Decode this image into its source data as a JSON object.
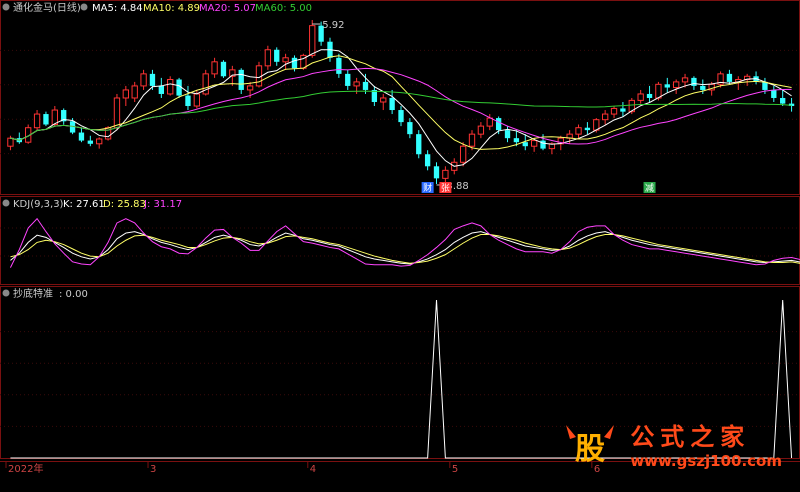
{
  "header": {
    "title": "通化金马(日线)",
    "ma": [
      {
        "label": "MA5: 4.84",
        "color": "#ffffff"
      },
      {
        "label": "MA10: 4.89",
        "color": "#ffff66"
      },
      {
        "label": "MA20: 5.07",
        "color": "#ff44ff"
      },
      {
        "label": "MA60: 5.00",
        "color": "#33cc33"
      }
    ]
  },
  "kdj_header": {
    "label": "KDJ(9,3,3)",
    "k": "K: 27.61",
    "d": "D: 25.83",
    "j": "J: 31.17",
    "colors": {
      "k": "#ffffff",
      "d": "#ffff66",
      "j": "#ff44ff"
    }
  },
  "signal_header": {
    "label": "抄底特准",
    "value": ": 0.00"
  },
  "chart_data": [
    {
      "type": "candlestick",
      "panel": "price",
      "annotations": [
        {
          "text": "5.92",
          "kind": "high"
        },
        {
          "text": "3.88",
          "kind": "low"
        }
      ],
      "markers": [
        "财",
        "张",
        "减"
      ],
      "ohlc": [
        [
          4.35,
          4.48,
          4.3,
          4.45
        ],
        [
          4.45,
          4.52,
          4.38,
          4.4
        ],
        [
          4.4,
          4.62,
          4.38,
          4.58
        ],
        [
          4.58,
          4.8,
          4.55,
          4.75
        ],
        [
          4.75,
          4.78,
          4.6,
          4.62
        ],
        [
          4.62,
          4.85,
          4.6,
          4.8
        ],
        [
          4.8,
          4.82,
          4.62,
          4.66
        ],
        [
          4.66,
          4.7,
          4.5,
          4.52
        ],
        [
          4.52,
          4.58,
          4.4,
          4.42
        ],
        [
          4.42,
          4.48,
          4.35,
          4.38
        ],
        [
          4.38,
          4.46,
          4.32,
          4.44
        ],
        [
          4.44,
          4.6,
          4.42,
          4.58
        ],
        [
          4.58,
          5.0,
          4.55,
          4.95
        ],
        [
          4.95,
          5.1,
          4.85,
          5.05
        ],
        [
          4.95,
          5.15,
          4.9,
          5.1
        ],
        [
          5.1,
          5.3,
          5.05,
          5.25
        ],
        [
          5.25,
          5.3,
          5.05,
          5.1
        ],
        [
          5.1,
          5.2,
          4.95,
          5.0
        ],
        [
          5.0,
          5.22,
          4.98,
          5.18
        ],
        [
          5.18,
          5.2,
          4.95,
          4.98
        ],
        [
          4.98,
          5.1,
          4.8,
          4.85
        ],
        [
          4.85,
          5.05,
          4.82,
          5.0
        ],
        [
          5.0,
          5.3,
          4.98,
          5.25
        ],
        [
          5.25,
          5.45,
          5.2,
          5.4
        ],
        [
          5.4,
          5.42,
          5.2,
          5.22
        ],
        [
          5.22,
          5.35,
          5.1,
          5.3
        ],
        [
          5.3,
          5.32,
          5.0,
          5.05
        ],
        [
          5.05,
          5.15,
          4.95,
          5.1
        ],
        [
          5.1,
          5.4,
          5.08,
          5.35
        ],
        [
          5.35,
          5.6,
          5.3,
          5.55
        ],
        [
          5.55,
          5.58,
          5.35,
          5.4
        ],
        [
          5.4,
          5.5,
          5.3,
          5.45
        ],
        [
          5.45,
          5.48,
          5.28,
          5.32
        ],
        [
          5.32,
          5.5,
          5.3,
          5.48
        ],
        [
          5.48,
          5.92,
          5.45,
          5.85
        ],
        [
          5.85,
          5.9,
          5.6,
          5.65
        ],
        [
          5.65,
          5.7,
          5.4,
          5.45
        ],
        [
          5.45,
          5.5,
          5.2,
          5.25
        ],
        [
          5.25,
          5.3,
          5.05,
          5.1
        ],
        [
          5.1,
          5.2,
          5.0,
          5.15
        ],
        [
          5.15,
          5.25,
          5.0,
          5.05
        ],
        [
          5.05,
          5.1,
          4.85,
          4.9
        ],
        [
          4.9,
          5.0,
          4.8,
          4.95
        ],
        [
          4.95,
          5.05,
          4.75,
          4.8
        ],
        [
          4.8,
          4.85,
          4.6,
          4.65
        ],
        [
          4.65,
          4.7,
          4.45,
          4.5
        ],
        [
          4.5,
          4.55,
          4.2,
          4.25
        ],
        [
          4.25,
          4.3,
          4.05,
          4.1
        ],
        [
          4.1,
          4.15,
          3.88,
          3.95
        ],
        [
          3.95,
          4.1,
          3.9,
          4.05
        ],
        [
          4.05,
          4.2,
          4.0,
          4.15
        ],
        [
          4.15,
          4.4,
          4.1,
          4.35
        ],
        [
          4.35,
          4.55,
          4.3,
          4.5
        ],
        [
          4.5,
          4.65,
          4.45,
          4.6
        ],
        [
          4.6,
          4.75,
          4.55,
          4.7
        ],
        [
          4.7,
          4.72,
          4.5,
          4.55
        ],
        [
          4.55,
          4.6,
          4.4,
          4.45
        ],
        [
          4.45,
          4.55,
          4.35,
          4.4
        ],
        [
          4.4,
          4.5,
          4.3,
          4.35
        ],
        [
          4.35,
          4.45,
          4.28,
          4.42
        ],
        [
          4.42,
          4.5,
          4.3,
          4.32
        ],
        [
          4.32,
          4.4,
          4.25,
          4.38
        ],
        [
          4.38,
          4.48,
          4.3,
          4.45
        ],
        [
          4.45,
          4.55,
          4.38,
          4.5
        ],
        [
          4.5,
          4.62,
          4.45,
          4.58
        ],
        [
          4.58,
          4.65,
          4.5,
          4.55
        ],
        [
          4.55,
          4.7,
          4.52,
          4.68
        ],
        [
          4.68,
          4.8,
          4.62,
          4.75
        ],
        [
          4.75,
          4.85,
          4.7,
          4.82
        ],
        [
          4.82,
          4.9,
          4.72,
          4.78
        ],
        [
          4.78,
          4.95,
          4.75,
          4.92
        ],
        [
          4.92,
          5.05,
          4.88,
          5.0
        ],
        [
          5.0,
          5.1,
          4.9,
          4.95
        ],
        [
          4.95,
          5.15,
          4.92,
          5.12
        ],
        [
          5.12,
          5.2,
          5.02,
          5.08
        ],
        [
          5.08,
          5.18,
          5.0,
          5.15
        ],
        [
          5.15,
          5.25,
          5.08,
          5.2
        ],
        [
          5.2,
          5.22,
          5.05,
          5.1
        ],
        [
          5.1,
          5.18,
          5.0,
          5.05
        ],
        [
          5.05,
          5.15,
          4.98,
          5.12
        ],
        [
          5.12,
          5.28,
          5.08,
          5.25
        ],
        [
          5.25,
          5.3,
          5.12,
          5.15
        ],
        [
          5.15,
          5.22,
          5.05,
          5.18
        ],
        [
          5.18,
          5.25,
          5.1,
          5.22
        ],
        [
          5.22,
          5.28,
          5.12,
          5.15
        ],
        [
          5.15,
          5.2,
          5.0,
          5.05
        ],
        [
          5.05,
          5.1,
          4.9,
          4.95
        ],
        [
          4.95,
          5.05,
          4.85,
          4.88
        ],
        [
          4.88,
          4.95,
          4.78,
          4.85
        ]
      ]
    },
    {
      "type": "line",
      "panel": "kdj",
      "ylim": [
        0,
        100
      ],
      "series": [
        {
          "name": "K",
          "color": "#ffffff",
          "values": [
            30,
            40,
            55,
            65,
            62,
            55,
            48,
            40,
            35,
            32,
            35,
            45,
            60,
            68,
            70,
            66,
            60,
            55,
            52,
            48,
            45,
            48,
            55,
            62,
            65,
            62,
            58,
            52,
            50,
            55,
            62,
            68,
            65,
            60,
            58,
            55,
            52,
            50,
            45,
            40,
            35,
            32,
            30,
            28,
            26,
            25,
            28,
            32,
            38,
            45,
            55,
            62,
            68,
            70,
            66,
            62,
            58,
            54,
            50,
            48,
            46,
            44,
            45,
            50,
            58,
            64,
            68,
            70,
            66,
            62,
            58,
            55,
            52,
            50,
            48,
            46,
            44,
            42,
            40,
            38,
            36,
            34,
            32,
            30,
            28,
            27,
            28,
            29,
            30,
            27.61
          ]
        },
        {
          "name": "D",
          "color": "#ffff66",
          "values": [
            35,
            38,
            45,
            55,
            58,
            56,
            52,
            46,
            40,
            36,
            35,
            40,
            50,
            58,
            64,
            65,
            62,
            58,
            55,
            52,
            48,
            48,
            52,
            57,
            61,
            62,
            60,
            56,
            53,
            54,
            58,
            63,
            64,
            62,
            60,
            57,
            54,
            52,
            48,
            44,
            40,
            36,
            33,
            30,
            28,
            26,
            27,
            29,
            33,
            38,
            46,
            54,
            61,
            66,
            66,
            64,
            61,
            58,
            54,
            51,
            48,
            46,
            45,
            47,
            52,
            58,
            63,
            66,
            66,
            64,
            61,
            58,
            55,
            52,
            50,
            48,
            46,
            44,
            42,
            40,
            38,
            36,
            34,
            32,
            30,
            28,
            27,
            27,
            28,
            25.83
          ]
        },
        {
          "name": "J",
          "color": "#ff44ff",
          "values": [
            20,
            45,
            75,
            88,
            70,
            53,
            40,
            28,
            25,
            24,
            35,
            55,
            82,
            88,
            82,
            68,
            56,
            49,
            46,
            40,
            39,
            48,
            61,
            72,
            73,
            62,
            54,
            44,
            44,
            57,
            70,
            78,
            67,
            56,
            54,
            51,
            48,
            46,
            39,
            32,
            25,
            24,
            24,
            24,
            22,
            23,
            30,
            38,
            48,
            59,
            73,
            78,
            82,
            78,
            66,
            58,
            52,
            46,
            42,
            42,
            42,
            40,
            45,
            56,
            70,
            76,
            78,
            78,
            66,
            58,
            52,
            49,
            46,
            46,
            44,
            42,
            40,
            38,
            36,
            34,
            32,
            30,
            28,
            26,
            24,
            25,
            30,
            33,
            34,
            31.17
          ]
        }
      ]
    },
    {
      "type": "line",
      "panel": "signal",
      "series": [
        {
          "name": "抄底特准",
          "color": "#ffffff",
          "spikes_at": [
            48,
            87
          ],
          "height": 1,
          "last": 0.0
        }
      ]
    }
  ],
  "xaxis": {
    "labels": [
      "2022年",
      "3",
      "4",
      "5",
      "6"
    ],
    "positions": [
      0,
      16,
      34,
      50,
      66
    ]
  },
  "watermark": {
    "text": "公式之家",
    "url": "www.gszj100.com",
    "logo_char": "股"
  }
}
